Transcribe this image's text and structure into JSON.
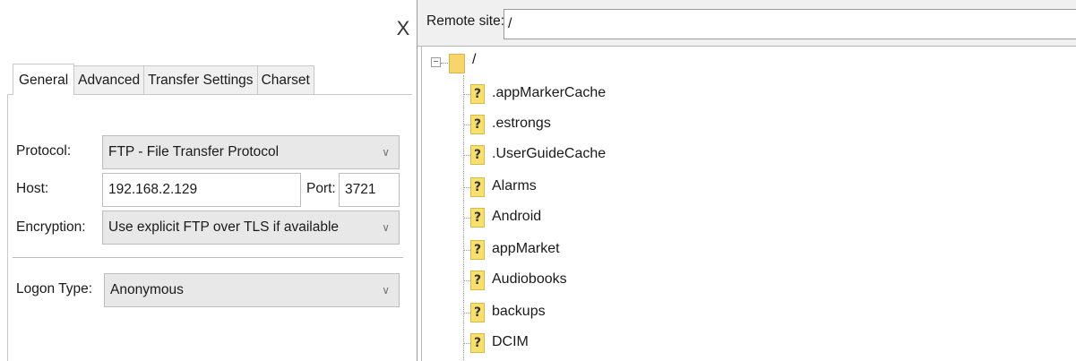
{
  "site_manager": {
    "close_label": "X",
    "tabs": [
      {
        "label": "General"
      },
      {
        "label": "Advanced"
      },
      {
        "label": "Transfer Settings"
      },
      {
        "label": "Charset"
      }
    ],
    "protocol_label": "Protocol:",
    "protocol_value": "FTP - File Transfer Protocol",
    "host_label": "Host:",
    "host_value": "192.168.2.129",
    "port_label": "Port:",
    "port_value": "3721",
    "encryption_label": "Encryption:",
    "encryption_value": "Use explicit FTP over TLS if available",
    "logon_type_label": "Logon Type:",
    "logon_type_value": "Anonymous",
    "dropdown_arrow": "∨"
  },
  "remote": {
    "label": "Remote site:",
    "path": "/",
    "root_label": "/",
    "expander": "−",
    "unknown_glyph": "?",
    "items": [
      {
        "label": ".appMarkerCache"
      },
      {
        "label": ".estrongs"
      },
      {
        "label": ".UserGuideCache"
      },
      {
        "label": "Alarms"
      },
      {
        "label": "Android"
      },
      {
        "label": "appMarket"
      },
      {
        "label": "Audiobooks"
      },
      {
        "label": "backups"
      },
      {
        "label": "DCIM"
      }
    ]
  }
}
